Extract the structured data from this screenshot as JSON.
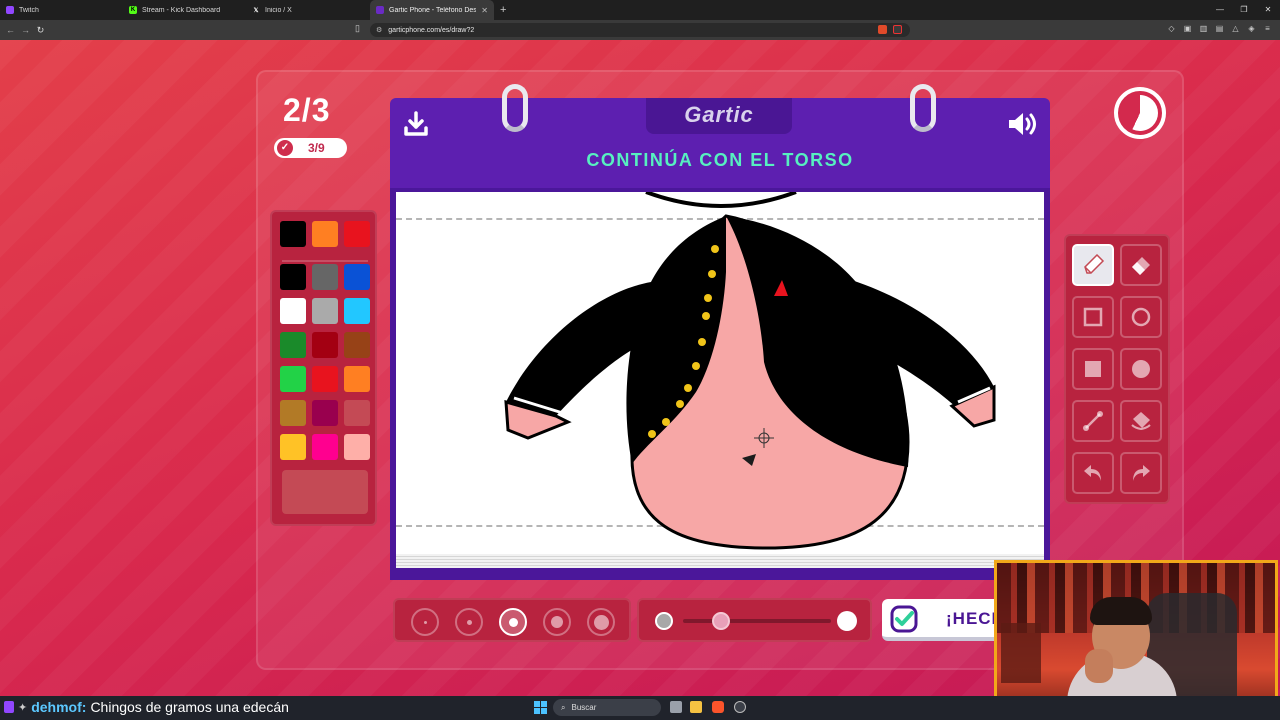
{
  "browser": {
    "tabs": [
      {
        "label": "Twitch",
        "icon": "twitch-icon",
        "color": "#9147ff",
        "active": false
      },
      {
        "label": "Stream - Kick Dashboard",
        "icon": "kick-icon",
        "color": "#53fc18",
        "active": false
      },
      {
        "label": "Inicio / X",
        "icon": "x-icon",
        "color": "#000000",
        "active": false
      },
      {
        "label": "Gartic Phone - Teléfono Descon",
        "icon": "gartic-icon",
        "color": "#6a2bc4",
        "active": true
      }
    ],
    "url": "garticphone.com/es/draw?2"
  },
  "game": {
    "round": "2/3",
    "players_done": "3/9",
    "logo": "Gartic",
    "prompt": "CONTINÚA CON EL TORSO",
    "done_button": "¡HECHO!",
    "selected_tool": "pencil",
    "selected_size_index": 2,
    "opacity_fraction": 0.14,
    "current_color": "#c44a55",
    "palette": [
      [
        "#000000",
        "#ff7f22",
        "#e8131e"
      ],
      [
        "#000000",
        "#666666",
        "#0a52d6"
      ],
      [
        "#ffffff",
        "#aaaaaa",
        "#22c7ff"
      ],
      [
        "#1a8a2a",
        "#a30012",
        "#974217"
      ],
      [
        "#22d247",
        "#e8131e",
        "#ff7f22"
      ],
      [
        "#b27a26",
        "#99004e",
        "#c44a55"
      ],
      [
        "#ffc226",
        "#ff008f",
        "#feafa8"
      ]
    ],
    "tools": [
      {
        "name": "pencil-tool",
        "icon": "pencil-icon"
      },
      {
        "name": "eraser-tool",
        "icon": "eraser-icon"
      },
      {
        "name": "rectangle-outline-tool",
        "icon": "square-outline-icon"
      },
      {
        "name": "ellipse-outline-tool",
        "icon": "circle-outline-icon"
      },
      {
        "name": "rectangle-fill-tool",
        "icon": "square-fill-icon"
      },
      {
        "name": "ellipse-fill-tool",
        "icon": "circle-fill-icon"
      },
      {
        "name": "line-tool",
        "icon": "line-icon"
      },
      {
        "name": "bucket-tool",
        "icon": "bucket-icon"
      },
      {
        "name": "undo-tool",
        "icon": "undo-icon"
      },
      {
        "name": "redo-tool",
        "icon": "redo-icon"
      }
    ]
  },
  "taskbar": {
    "chat_user": "dehmof:",
    "chat_message": "Chingos de gramos una edecán",
    "search_placeholder": "Buscar"
  }
}
